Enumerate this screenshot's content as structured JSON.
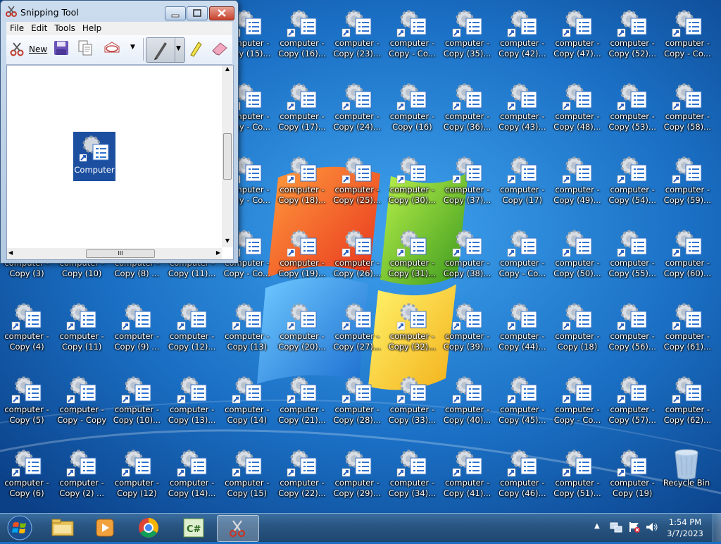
{
  "window": {
    "title": "Snipping Tool",
    "menus": [
      "File",
      "Edit",
      "Tools",
      "Help"
    ],
    "toolbar": {
      "new_label": "New"
    },
    "snip_label": "Computer",
    "scroll_grip": "III"
  },
  "desktop_icons": [
    {
      "col": 4,
      "row": 0,
      "l1": "computer -",
      "l2": "Copy (15)..."
    },
    {
      "col": 5,
      "row": 0,
      "l1": "computer -",
      "l2": "Copy (16)..."
    },
    {
      "col": 6,
      "row": 0,
      "l1": "computer -",
      "l2": "Copy (23)..."
    },
    {
      "col": 7,
      "row": 0,
      "l1": "computer -",
      "l2": "Copy - Co..."
    },
    {
      "col": 8,
      "row": 0,
      "l1": "computer -",
      "l2": "Copy (35)..."
    },
    {
      "col": 9,
      "row": 0,
      "l1": "computer -",
      "l2": "Copy (42)..."
    },
    {
      "col": 10,
      "row": 0,
      "l1": "computer -",
      "l2": "Copy (47)..."
    },
    {
      "col": 11,
      "row": 0,
      "l1": "computer -",
      "l2": "Copy (52)..."
    },
    {
      "col": 12,
      "row": 0,
      "l1": "computer -",
      "l2": "Copy - Co..."
    },
    {
      "col": 4,
      "row": 1,
      "l1": "computer -",
      "l2": "Copy - Co..."
    },
    {
      "col": 5,
      "row": 1,
      "l1": "computer -",
      "l2": "Copy (17)..."
    },
    {
      "col": 6,
      "row": 1,
      "l1": "computer -",
      "l2": "Copy (24)..."
    },
    {
      "col": 7,
      "row": 1,
      "l1": "computer -",
      "l2": "Copy (16)"
    },
    {
      "col": 8,
      "row": 1,
      "l1": "computer -",
      "l2": "Copy (36)..."
    },
    {
      "col": 9,
      "row": 1,
      "l1": "computer -",
      "l2": "Copy (43)..."
    },
    {
      "col": 10,
      "row": 1,
      "l1": "computer -",
      "l2": "Copy (48)..."
    },
    {
      "col": 11,
      "row": 1,
      "l1": "computer -",
      "l2": "Copy (53)..."
    },
    {
      "col": 12,
      "row": 1,
      "l1": "computer -",
      "l2": "Copy (58)..."
    },
    {
      "col": 4,
      "row": 2,
      "l1": "computer -",
      "l2": "Copy - Co..."
    },
    {
      "col": 5,
      "row": 2,
      "l1": "computer -",
      "l2": "Copy (18)..."
    },
    {
      "col": 6,
      "row": 2,
      "l1": "computer -",
      "l2": "Copy (25)..."
    },
    {
      "col": 7,
      "row": 2,
      "l1": "computer -",
      "l2": "Copy (30)..."
    },
    {
      "col": 8,
      "row": 2,
      "l1": "computer -",
      "l2": "Copy (37)..."
    },
    {
      "col": 9,
      "row": 2,
      "l1": "computer -",
      "l2": "Copy (17)"
    },
    {
      "col": 10,
      "row": 2,
      "l1": "computer -",
      "l2": "Copy (49)..."
    },
    {
      "col": 11,
      "row": 2,
      "l1": "computer -",
      "l2": "Copy (54)..."
    },
    {
      "col": 12,
      "row": 2,
      "l1": "computer -",
      "l2": "Copy (59)..."
    },
    {
      "col": 0,
      "row": 3,
      "l1": "computer -",
      "l2": "Copy (3)"
    },
    {
      "col": 1,
      "row": 3,
      "l1": "computer -",
      "l2": "Copy (10)"
    },
    {
      "col": 2,
      "row": 3,
      "l1": "computer -",
      "l2": "Copy (8) ..."
    },
    {
      "col": 3,
      "row": 3,
      "l1": "computer -",
      "l2": "Copy (11)..."
    },
    {
      "col": 4,
      "row": 3,
      "l1": "computer -",
      "l2": "Copy - Co..."
    },
    {
      "col": 5,
      "row": 3,
      "l1": "computer -",
      "l2": "Copy (19)..."
    },
    {
      "col": 6,
      "row": 3,
      "l1": "computer -",
      "l2": "Copy (26)..."
    },
    {
      "col": 7,
      "row": 3,
      "l1": "computer -",
      "l2": "Copy (31)..."
    },
    {
      "col": 8,
      "row": 3,
      "l1": "computer -",
      "l2": "Copy (38)..."
    },
    {
      "col": 9,
      "row": 3,
      "l1": "computer -",
      "l2": "Copy - Co..."
    },
    {
      "col": 10,
      "row": 3,
      "l1": "computer -",
      "l2": "Copy (50)..."
    },
    {
      "col": 11,
      "row": 3,
      "l1": "computer -",
      "l2": "Copy (55)..."
    },
    {
      "col": 12,
      "row": 3,
      "l1": "computer -",
      "l2": "Copy (60)..."
    },
    {
      "col": 0,
      "row": 4,
      "l1": "computer -",
      "l2": "Copy (4)"
    },
    {
      "col": 1,
      "row": 4,
      "l1": "computer -",
      "l2": "Copy (11)"
    },
    {
      "col": 2,
      "row": 4,
      "l1": "computer -",
      "l2": "Copy (9) ..."
    },
    {
      "col": 3,
      "row": 4,
      "l1": "computer -",
      "l2": "Copy (12)..."
    },
    {
      "col": 4,
      "row": 4,
      "l1": "computer -",
      "l2": "Copy (13)"
    },
    {
      "col": 5,
      "row": 4,
      "l1": "computer -",
      "l2": "Copy (20)..."
    },
    {
      "col": 6,
      "row": 4,
      "l1": "computer -",
      "l2": "Copy (27)..."
    },
    {
      "col": 7,
      "row": 4,
      "l1": "computer -",
      "l2": "Copy (32)..."
    },
    {
      "col": 8,
      "row": 4,
      "l1": "computer -",
      "l2": "Copy (39)..."
    },
    {
      "col": 9,
      "row": 4,
      "l1": "computer -",
      "l2": "Copy (44)..."
    },
    {
      "col": 10,
      "row": 4,
      "l1": "computer -",
      "l2": "Copy (18)"
    },
    {
      "col": 11,
      "row": 4,
      "l1": "computer -",
      "l2": "Copy (56)..."
    },
    {
      "col": 12,
      "row": 4,
      "l1": "computer -",
      "l2": "Copy (61)..."
    },
    {
      "col": 0,
      "row": 5,
      "l1": "computer -",
      "l2": "Copy (5)"
    },
    {
      "col": 1,
      "row": 5,
      "l1": "computer -",
      "l2": "Copy - Copy"
    },
    {
      "col": 2,
      "row": 5,
      "l1": "computer -",
      "l2": "Copy (10)..."
    },
    {
      "col": 3,
      "row": 5,
      "l1": "computer -",
      "l2": "Copy (13)..."
    },
    {
      "col": 4,
      "row": 5,
      "l1": "computer -",
      "l2": "Copy (14)"
    },
    {
      "col": 5,
      "row": 5,
      "l1": "computer -",
      "l2": "Copy (21)..."
    },
    {
      "col": 6,
      "row": 5,
      "l1": "computer -",
      "l2": "Copy (28)..."
    },
    {
      "col": 7,
      "row": 5,
      "l1": "computer -",
      "l2": "Copy (33)..."
    },
    {
      "col": 8,
      "row": 5,
      "l1": "computer -",
      "l2": "Copy (40)..."
    },
    {
      "col": 9,
      "row": 5,
      "l1": "computer -",
      "l2": "Copy (45)..."
    },
    {
      "col": 10,
      "row": 5,
      "l1": "computer -",
      "l2": "Copy - Co..."
    },
    {
      "col": 11,
      "row": 5,
      "l1": "computer -",
      "l2": "Copy (57)..."
    },
    {
      "col": 12,
      "row": 5,
      "l1": "computer -",
      "l2": "Copy (62)..."
    },
    {
      "col": 0,
      "row": 6,
      "l1": "computer -",
      "l2": "Copy (6)"
    },
    {
      "col": 1,
      "row": 6,
      "l1": "computer -",
      "l2": "Copy (2) ..."
    },
    {
      "col": 2,
      "row": 6,
      "l1": "computer -",
      "l2": "Copy (12)"
    },
    {
      "col": 3,
      "row": 6,
      "l1": "computer -",
      "l2": "Copy (14)..."
    },
    {
      "col": 4,
      "row": 6,
      "l1": "computer -",
      "l2": "Copy (15)"
    },
    {
      "col": 5,
      "row": 6,
      "l1": "computer -",
      "l2": "Copy (22)..."
    },
    {
      "col": 6,
      "row": 6,
      "l1": "computer -",
      "l2": "Copy (29)..."
    },
    {
      "col": 7,
      "row": 6,
      "l1": "computer -",
      "l2": "Copy (34)..."
    },
    {
      "col": 8,
      "row": 6,
      "l1": "computer -",
      "l2": "Copy (41)..."
    },
    {
      "col": 9,
      "row": 6,
      "l1": "computer -",
      "l2": "Copy (46)..."
    },
    {
      "col": 10,
      "row": 6,
      "l1": "computer -",
      "l2": "Copy (51)..."
    },
    {
      "col": 11,
      "row": 6,
      "l1": "computer -",
      "l2": "Copy (19)"
    }
  ],
  "recycle_bin": {
    "label": "Recycle Bin"
  },
  "taskbar": {
    "apps": [
      "start-orb",
      "explorer",
      "media-player",
      "chrome",
      "csharp-app",
      "snipping-tool"
    ],
    "active": "snipping-tool",
    "clock_time": "1:54 PM",
    "clock_date": "3/7/2023"
  },
  "colors": {
    "desktop_blue": "#1a6fc4",
    "taskbar": "#2a5683",
    "selection": "#1c4fa0"
  }
}
